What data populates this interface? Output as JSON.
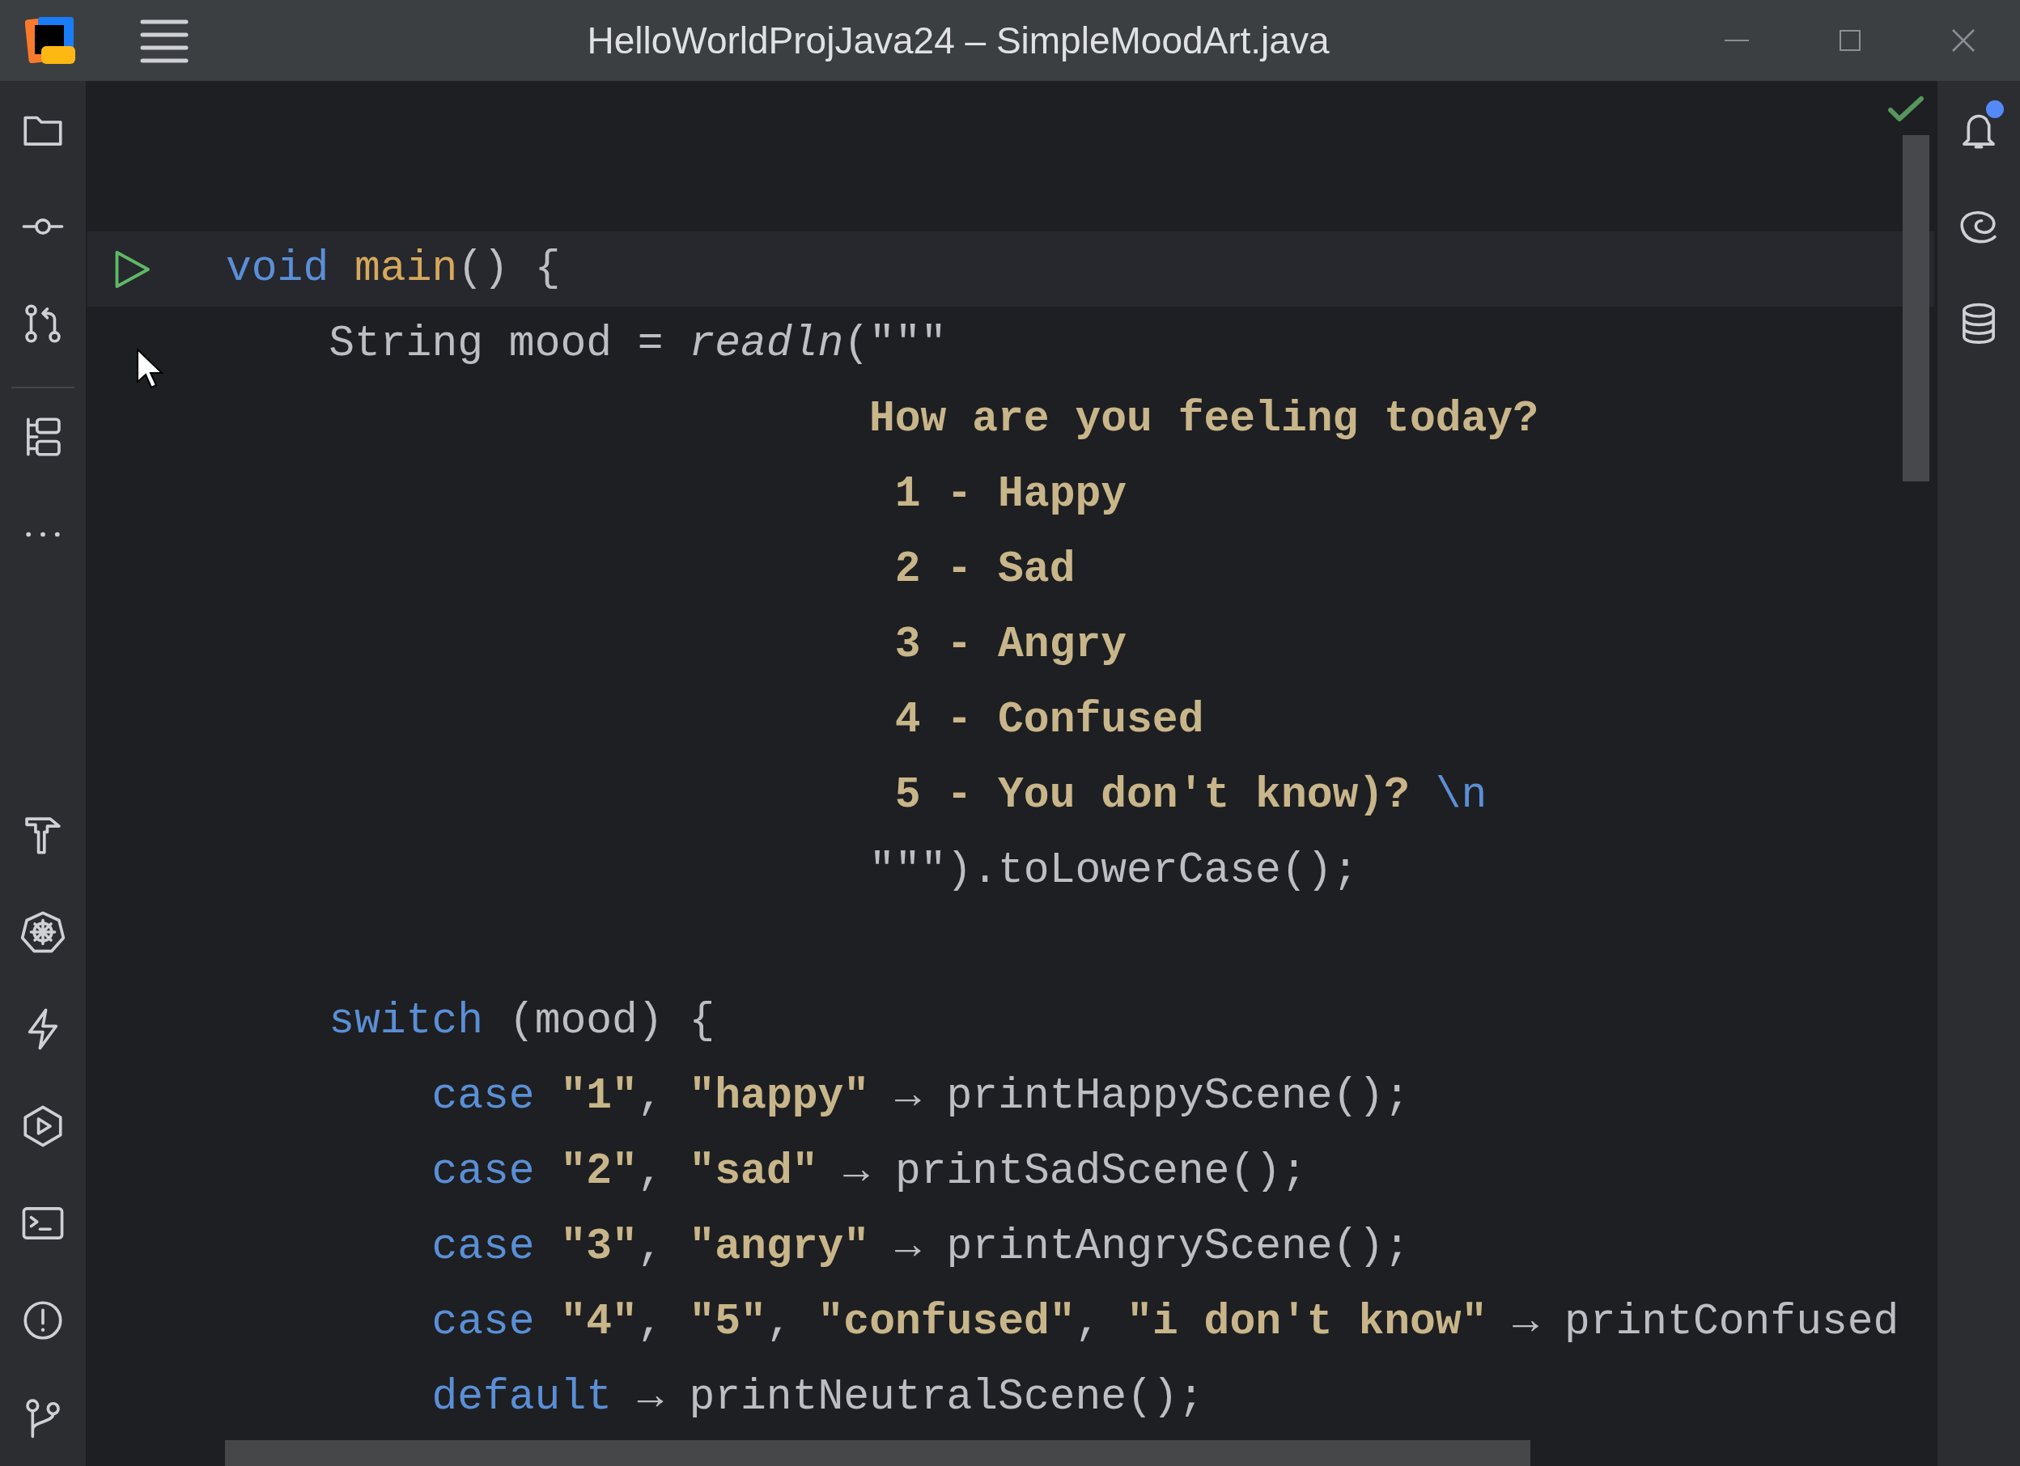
{
  "window": {
    "title": "HelloWorldProjJava24 – SimpleMoodArt.java"
  },
  "editor": {
    "lines": [
      {
        "kind": "blank"
      },
      {
        "kind": "blank"
      },
      {
        "kind": "code",
        "current": true,
        "run_button": true,
        "tokens": [
          {
            "kind": "keyword",
            "text": "void "
          },
          {
            "kind": "method",
            "text": "main"
          },
          {
            "kind": "plain",
            "text": "() {"
          }
        ],
        "children": [
          {
            "kind": "code",
            "current": false,
            "run_button": false,
            "tokens": [
              {
                "kind": "plain",
                "text": "String mood = "
              },
              {
                "kind": "italic",
                "text": "readln"
              },
              {
                "kind": "plain",
                "text": "(\"\"\""
              }
            ]
          },
          {
            "kind": "text_block",
            "current": false,
            "run_button": false,
            "tokens": [
              {
                "kind": "string",
                "text": "How are you feeling today?"
              }
            ]
          },
          {
            "kind": "text_block",
            "current": false,
            "run_button": false,
            "tokens": [
              {
                "kind": "string",
                "text": " 1 - Happy"
              }
            ]
          },
          {
            "kind": "text_block",
            "current": false,
            "run_button": false,
            "tokens": [
              {
                "kind": "string",
                "text": " 2 - Sad"
              }
            ]
          },
          {
            "kind": "text_block",
            "current": false,
            "run_button": false,
            "tokens": [
              {
                "kind": "string",
                "text": " 3 - Angry"
              }
            ]
          },
          {
            "kind": "text_block",
            "current": false,
            "run_button": false,
            "tokens": [
              {
                "kind": "string",
                "text": " 4 - Confused"
              }
            ]
          },
          {
            "kind": "text_block",
            "current": false,
            "run_button": false,
            "tokens": [
              {
                "kind": "string",
                "text": " 5 - You don't know)? "
              },
              {
                "kind": "escape",
                "text": "\\n"
              }
            ]
          },
          {
            "kind": "text_block",
            "current": false,
            "run_button": false,
            "tokens": [
              {
                "kind": "plain",
                "text": "\"\"\").toLowerCase();"
              }
            ]
          },
          {
            "kind": "blank"
          },
          {
            "kind": "code",
            "current": false,
            "run_button": false,
            "tokens": [
              {
                "kind": "keyword",
                "text": "switch"
              },
              {
                "kind": "plain",
                "text": " (mood) {"
              }
            ],
            "children": [
              {
                "kind": "code",
                "current": false,
                "run_button": false,
                "tokens": [
                  {
                    "kind": "keyword",
                    "text": "case "
                  },
                  {
                    "kind": "string",
                    "text": "\"1\""
                  },
                  {
                    "kind": "plain",
                    "text": ", "
                  },
                  {
                    "kind": "string",
                    "text": "\"happy\""
                  },
                  {
                    "kind": "plain",
                    "text": " → printHappyScene();"
                  }
                ]
              },
              {
                "kind": "code",
                "current": false,
                "run_button": false,
                "tokens": [
                  {
                    "kind": "keyword",
                    "text": "case "
                  },
                  {
                    "kind": "string",
                    "text": "\"2\""
                  },
                  {
                    "kind": "plain",
                    "text": ", "
                  },
                  {
                    "kind": "string",
                    "text": "\"sad\""
                  },
                  {
                    "kind": "plain",
                    "text": " → printSadScene();"
                  }
                ]
              },
              {
                "kind": "code",
                "current": false,
                "run_button": false,
                "tokens": [
                  {
                    "kind": "keyword",
                    "text": "case "
                  },
                  {
                    "kind": "string",
                    "text": "\"3\""
                  },
                  {
                    "kind": "plain",
                    "text": ", "
                  },
                  {
                    "kind": "string",
                    "text": "\"angry\""
                  },
                  {
                    "kind": "plain",
                    "text": " → printAngryScene();"
                  }
                ]
              },
              {
                "kind": "code",
                "current": false,
                "run_button": false,
                "tokens": [
                  {
                    "kind": "keyword",
                    "text": "case "
                  },
                  {
                    "kind": "string",
                    "text": "\"4\""
                  },
                  {
                    "kind": "plain",
                    "text": ", "
                  },
                  {
                    "kind": "string",
                    "text": "\"5\""
                  },
                  {
                    "kind": "plain",
                    "text": ", "
                  },
                  {
                    "kind": "string",
                    "text": "\"confused\""
                  },
                  {
                    "kind": "plain",
                    "text": ", "
                  },
                  {
                    "kind": "string",
                    "text": "\"i don't know\""
                  },
                  {
                    "kind": "plain",
                    "text": " → printConfused"
                  }
                ]
              },
              {
                "kind": "code",
                "current": false,
                "run_button": false,
                "tokens": [
                  {
                    "kind": "keyword",
                    "text": "default"
                  },
                  {
                    "kind": "plain",
                    "text": " → printNeutralScene();"
                  }
                ]
              }
            ]
          }
        ]
      }
    ]
  },
  "notifications": {
    "unread": true
  }
}
